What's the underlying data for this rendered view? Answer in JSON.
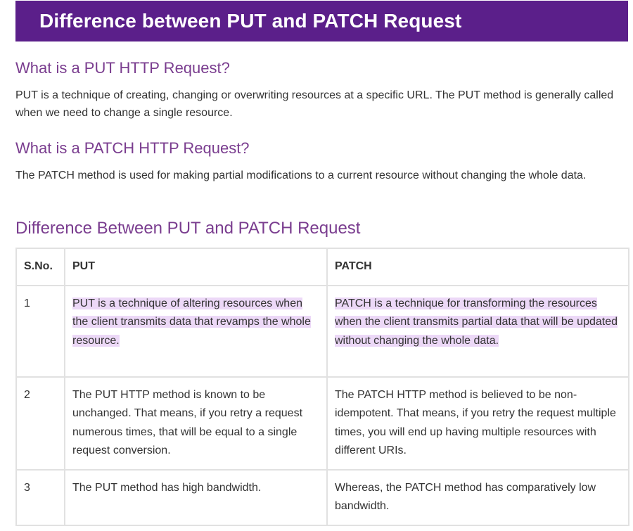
{
  "banner": {
    "title": "Difference between PUT and PATCH Request"
  },
  "sections": {
    "put": {
      "heading": "What is a PUT HTTP Request?",
      "body": "PUT is a technique of creating, changing or overwriting resources at a specific URL. The PUT method is generally called when we need to change a single resource."
    },
    "patch": {
      "heading": "What is a PATCH HTTP Request?",
      "body": "The PATCH method is used for making partial modifications to a current resource without changing the whole data."
    },
    "difference": {
      "heading": "Difference Between PUT and PATCH Request"
    }
  },
  "table": {
    "headers": [
      "S.No.",
      "PUT",
      "PATCH"
    ],
    "rows": [
      {
        "sno": "1",
        "put": "PUT is a technique of altering resources when the client transmits data that revamps the whole resource.",
        "patch": "PATCH is a technique for transforming the resources when the client transmits partial data that will be updated without changing the whole data."
      },
      {
        "sno": "2",
        "put": "The PUT HTTP method is known to be unchanged. That means, if you retry a request numerous times, that will be equal to a single request conversion.",
        "patch": "The PATCH HTTP method is believed to be non-idempotent. That means, if you retry the request multiple times, you will end up having multiple resources with different URIs."
      },
      {
        "sno": "3",
        "put": "The PUT method has high bandwidth.",
        "patch": "Whereas, the PATCH method has comparatively low bandwidth."
      }
    ]
  },
  "colors": {
    "banner_bg": "#5b1f8a",
    "heading": "#7a3d8f",
    "highlight": "#ecd8f7"
  }
}
